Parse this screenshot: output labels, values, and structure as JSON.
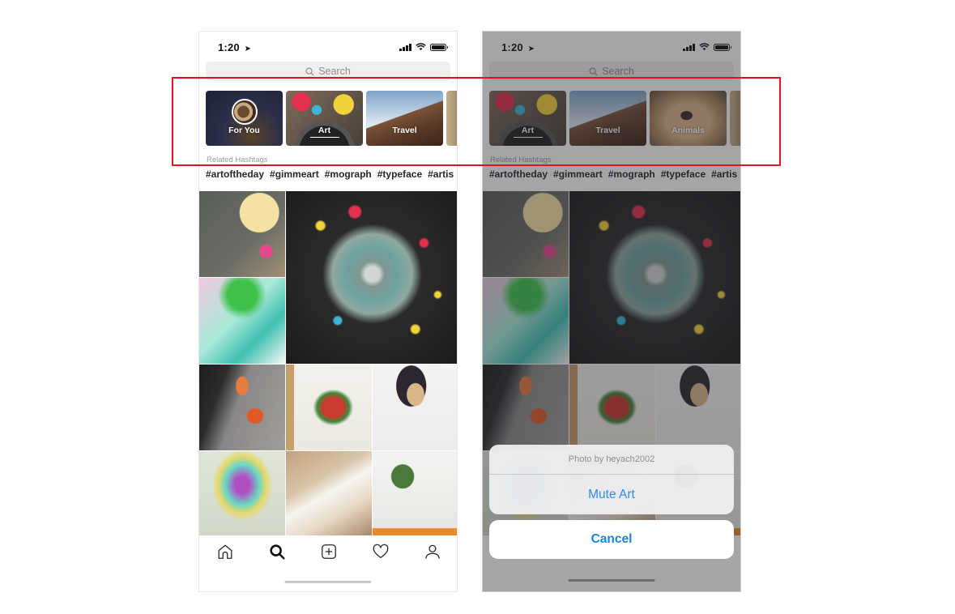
{
  "screens": [
    {
      "id": "left",
      "status_bar": {
        "time": "1:20",
        "location_icon": "location-arrow-icon",
        "icons": [
          "signal-icon",
          "wifi-icon",
          "battery-icon"
        ]
      },
      "search": {
        "placeholder": "Search",
        "icon": "search-icon"
      },
      "topics": [
        {
          "label": "For You",
          "has_avatar": true,
          "selected": false
        },
        {
          "label": "Art",
          "selected": true
        },
        {
          "label": "Travel",
          "selected": false
        }
      ],
      "related_hashtags_label": "Related Hashtags",
      "hashtags": [
        "#artoftheday",
        "#gimmeart",
        "#mograph",
        "#typeface",
        "#artis"
      ],
      "tab_bar": [
        {
          "name": "home",
          "icon": "home-icon",
          "active": false
        },
        {
          "name": "search",
          "icon": "search-icon",
          "active": true
        },
        {
          "name": "new-post",
          "icon": "plus-square-icon",
          "active": false
        },
        {
          "name": "activity",
          "icon": "heart-icon",
          "active": false
        },
        {
          "name": "profile",
          "icon": "person-icon",
          "active": false
        }
      ]
    },
    {
      "id": "right",
      "status_bar": {
        "time": "1:20",
        "location_icon": "location-arrow-icon",
        "icons": [
          "signal-icon",
          "wifi-icon",
          "battery-icon"
        ]
      },
      "search": {
        "placeholder": "Search",
        "icon": "search-icon"
      },
      "topics": [
        {
          "label": "Art",
          "selected": true
        },
        {
          "label": "Travel",
          "selected": false
        },
        {
          "label": "Animals",
          "selected": false
        }
      ],
      "related_hashtags_label": "Related Hashtags",
      "hashtags": [
        "#artoftheday",
        "#gimmeart",
        "#mograph",
        "#typeface",
        "#artis"
      ],
      "action_sheet": {
        "title": "Photo by heyach2002",
        "action": "Mute Art",
        "cancel": "Cancel"
      }
    }
  ],
  "colors": {
    "action_blue": "#2f8be8",
    "cancel_blue": "#1a84e6",
    "highlight_red": "#e0141e"
  }
}
